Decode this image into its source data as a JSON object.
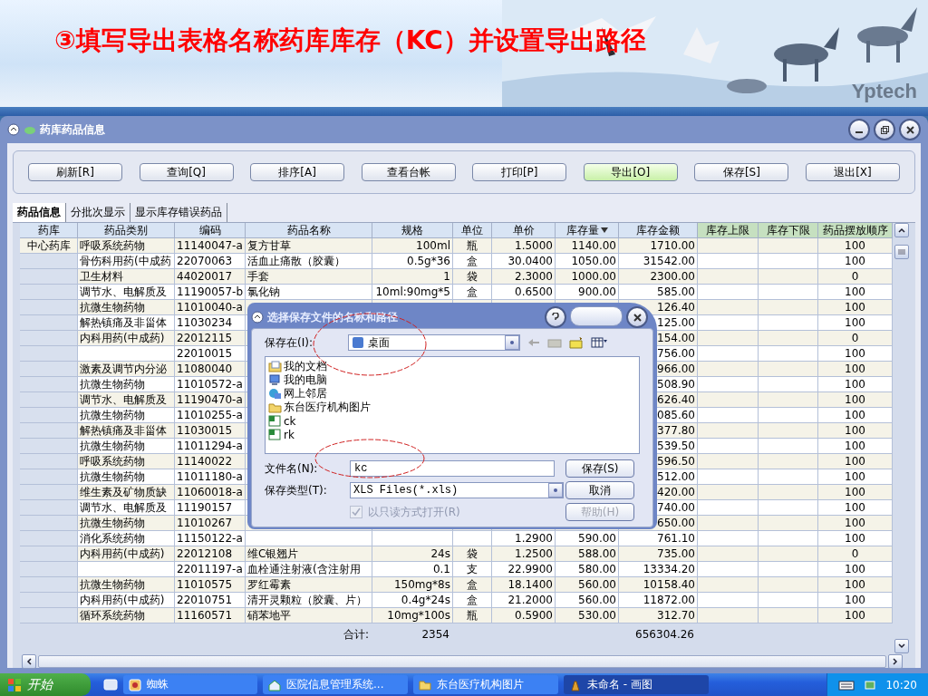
{
  "banner": {
    "title": "③填写导出表格名称药库库存（KC）并设置导出路径",
    "logo": "Yptech"
  },
  "window": {
    "title": "药库药品信息"
  },
  "toolbar": [
    {
      "label": "刷新[R]",
      "highlighted": false
    },
    {
      "label": "查询[Q]",
      "highlighted": false
    },
    {
      "label": "排序[A]",
      "highlighted": false
    },
    {
      "label": "查看台帐",
      "highlighted": false
    },
    {
      "label": "打印[P]",
      "highlighted": false
    },
    {
      "label": "导出[O]",
      "highlighted": true
    },
    {
      "label": "保存[S]",
      "highlighted": false
    },
    {
      "label": "退出[X]",
      "highlighted": false
    }
  ],
  "tabs": [
    {
      "label": "药品信息",
      "selected": true
    },
    {
      "label": "分批次显示",
      "selected": false
    },
    {
      "label": "显示库存错误药品",
      "selected": false
    }
  ],
  "table": {
    "columns": [
      {
        "label": "药库",
        "kind": "data"
      },
      {
        "label": "药品类别",
        "kind": "data"
      },
      {
        "label": "编码",
        "kind": "data"
      },
      {
        "label": "药品名称",
        "kind": "data"
      },
      {
        "label": "规格",
        "kind": "data"
      },
      {
        "label": "单位",
        "kind": "data"
      },
      {
        "label": "单价",
        "kind": "data"
      },
      {
        "label": "库存量",
        "kind": "data",
        "sort_descending": true
      },
      {
        "label": "库存金额",
        "kind": "data"
      },
      {
        "label": "库存上限",
        "kind": "setting"
      },
      {
        "label": "库存下限",
        "kind": "setting"
      },
      {
        "label": "药品摆放顺序",
        "kind": "setting"
      }
    ],
    "rows": [
      {
        "store": "中心药库",
        "category": "呼吸系统药物",
        "code": "11140047-a",
        "name": "复方甘草",
        "spec": "100ml",
        "unit": "瓶",
        "price": "1.5000",
        "qty": "1140.00",
        "amount": "1710.00",
        "order": "100"
      },
      {
        "category": "骨伤科用药(中成药",
        "code": "22070063",
        "name": "活血止痛散（胶囊）",
        "spec": "0.5g*36",
        "unit": "盒",
        "price": "30.0400",
        "qty": "1050.00",
        "amount": "31542.00",
        "order": "100"
      },
      {
        "category": "卫生材料",
        "code": "44020017",
        "name": "手套",
        "spec": "1",
        "unit": "袋",
        "price": "2.3000",
        "qty": "1000.00",
        "amount": "2300.00",
        "order": "0"
      },
      {
        "category": "调节水、电解质及",
        "code": "11190057-b",
        "name": "氯化钠",
        "spec": "10ml:90mg*5",
        "unit": "盒",
        "price": "0.6500",
        "qty": "900.00",
        "amount": "585.00",
        "order": "100"
      },
      {
        "category": "抗微生物药物",
        "code": "11010040-a",
        "amount": "126.40",
        "order": "100"
      },
      {
        "category": "解热镇痛及非甾体",
        "code": "11030234",
        "amount": "125.00",
        "order": "100"
      },
      {
        "category": "内科用药(中成药)",
        "code": "22012115",
        "amount": "154.00",
        "order": "0"
      },
      {
        "code": "22010015",
        "amount": "756.00",
        "order": "100"
      },
      {
        "category": "激素及调节内分泌",
        "code": "11080040",
        "amount": "966.00",
        "order": "100"
      },
      {
        "category": "抗微生物药物",
        "code": "11010572-a",
        "amount": "508.90",
        "order": "100"
      },
      {
        "category": "调节水、电解质及",
        "code": "11190470-a",
        "amount": "626.40",
        "order": "100"
      },
      {
        "category": "抗微生物药物",
        "code": "11010255-a",
        "amount": "085.60",
        "order": "100"
      },
      {
        "category": "解热镇痛及非甾体",
        "code": "11030015",
        "amount": "377.80",
        "order": "100"
      },
      {
        "category": "抗微生物药物",
        "code": "11011294-a",
        "amount": "539.50",
        "order": "100"
      },
      {
        "category": "呼吸系统药物",
        "code": "11140022",
        "amount": "596.50",
        "order": "100"
      },
      {
        "category": "抗微生物药物",
        "code": "11011180-a",
        "amount": "512.00",
        "order": "100"
      },
      {
        "category": "维生素及矿物质缺",
        "code": "11060018-a",
        "amount": "420.00",
        "order": "100"
      },
      {
        "category": "调节水、电解质及",
        "code": "11190157",
        "amount": "740.00",
        "order": "100"
      },
      {
        "category": "抗微生物药物",
        "code": "11010267",
        "amount": "650.00",
        "order": "100"
      },
      {
        "category": "消化系统药物",
        "code": "11150122-a",
        "price": "1.2900",
        "qty": "590.00",
        "amount": "761.10",
        "order": "100"
      },
      {
        "category": "内科用药(中成药)",
        "code": "22012108",
        "name": "维C银翘片",
        "spec": "24s",
        "unit": "袋",
        "price": "1.2500",
        "qty": "588.00",
        "amount": "735.00",
        "order": "0"
      },
      {
        "code": "22011197-a",
        "name": "血栓通注射液(含注射用",
        "spec": "0.1",
        "unit": "支",
        "price": "22.9900",
        "qty": "580.00",
        "amount": "13334.20",
        "order": "100"
      },
      {
        "category": "抗微生物药物",
        "code": "11010575",
        "name": "罗红霉素",
        "spec": "150mg*8s",
        "unit": "盒",
        "price": "18.1400",
        "qty": "560.00",
        "amount": "10158.40",
        "order": "100"
      },
      {
        "category": "内科用药(中成药)",
        "code": "22010751",
        "name": "清开灵颗粒（胶囊、片）",
        "spec": "0.4g*24s",
        "unit": "盒",
        "price": "21.2000",
        "qty": "560.00",
        "amount": "11872.00",
        "order": "100"
      },
      {
        "category": "循环系统药物",
        "code": "11160571",
        "name": "硝苯地平",
        "spec": "10mg*100s",
        "unit": "瓶",
        "price": "0.5900",
        "qty": "530.00",
        "amount": "312.70",
        "order": "100"
      }
    ],
    "totals": {
      "label": "合计:",
      "qty": "2354",
      "amount": "656304.26"
    }
  },
  "dialog": {
    "title": "选择保存文件的名称和路径",
    "save_in_label": "保存在(I):",
    "location": "桌面",
    "files": [
      {
        "name": "我的文档",
        "kind": "documents"
      },
      {
        "name": "我的电脑",
        "kind": "computer"
      },
      {
        "name": "网上邻居",
        "kind": "network"
      },
      {
        "name": "东台医疗机构图片",
        "kind": "folder"
      },
      {
        "name": "ck",
        "kind": "sheet"
      },
      {
        "name": "rk",
        "kind": "sheet"
      }
    ],
    "file_name_label": "文件名(N):",
    "file_name": "kc",
    "type_label": "保存类型(T):",
    "file_type": "XLS Files(*.xls)",
    "read_only": {
      "label": "以只读方式打开(R)",
      "checked": true,
      "disabled": true
    },
    "buttons": [
      {
        "label": "保存(S)",
        "disabled": false
      },
      {
        "label": "取消",
        "disabled": false
      },
      {
        "label": "帮助(H)",
        "disabled": true
      }
    ]
  },
  "taskbar": {
    "start": "开始",
    "tasks": [
      {
        "label": "蜘蛛",
        "kind": "game",
        "selected": false
      },
      {
        "label": "医院信息管理系统...",
        "kind": "app",
        "selected": false
      },
      {
        "label": "东台医疗机构图片",
        "kind": "folder",
        "selected": false
      },
      {
        "label": "未命名 - 画图",
        "kind": "paint",
        "selected": true
      }
    ],
    "clock": "10:20"
  }
}
